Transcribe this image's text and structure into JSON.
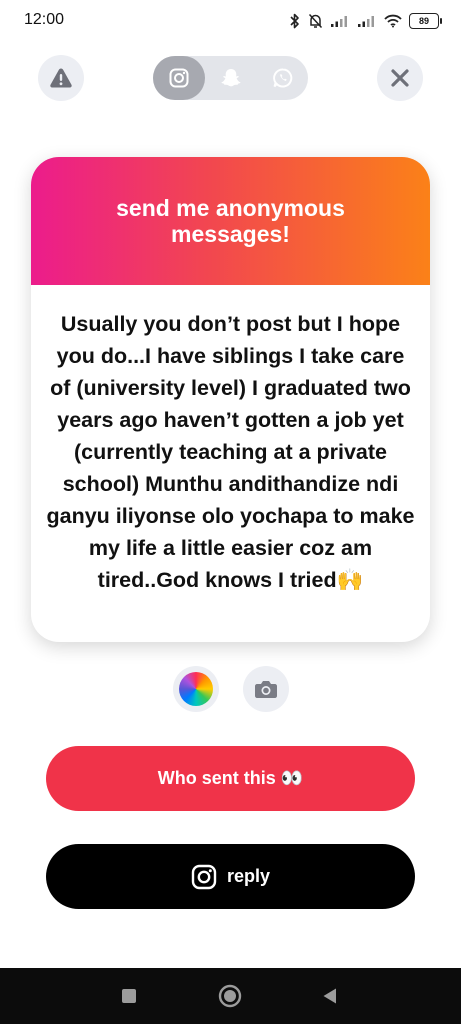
{
  "status_bar": {
    "time": "12:00",
    "battery": "89"
  },
  "top_bar": {
    "report_icon": "warning-icon",
    "close_icon": "close-icon",
    "share_targets": [
      {
        "name": "instagram",
        "icon": "instagram-icon",
        "selected": true
      },
      {
        "name": "snapchat",
        "icon": "snapchat-icon",
        "selected": false
      },
      {
        "name": "whatsapp",
        "icon": "whatsapp-icon",
        "selected": false
      }
    ]
  },
  "card": {
    "title": "send me anonymous messages!",
    "message": "Usually you don’t post but I hope you do...I have siblings I take care of (university level) I graduated two years ago haven’t gotten a job yet (currently teaching at a private school) Munthu andithandize ndi ganyu iliyonse olo yochapa to make my life a little easier coz am tired..God knows I tried🙌",
    "gradient_colors": [
      "#ec1c8c",
      "#fb8118"
    ]
  },
  "tools": {
    "color_icon": "color-wheel-icon",
    "camera_icon": "camera-icon"
  },
  "buttons": {
    "who_sent": "Who sent this 👀",
    "reply": "reply",
    "who_color": "#f03349",
    "reply_color": "#000000"
  },
  "nav_bar": {
    "items": [
      "recents-icon",
      "home-icon",
      "back-icon"
    ]
  }
}
